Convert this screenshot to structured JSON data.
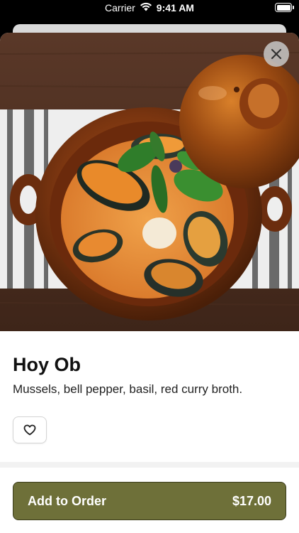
{
  "status_bar": {
    "carrier": "Carrier",
    "time": "9:41 AM",
    "icons": [
      "wifi-icon",
      "battery-icon"
    ]
  },
  "item": {
    "title": "Hoy Ob",
    "description": "Mussels, bell pepper, basil, red curry broth."
  },
  "actions": {
    "close_icon": "close-icon",
    "favorite_icon": "heart-outline-icon",
    "add_to_order_label": "Add to Order",
    "price": "$17.00"
  },
  "colors": {
    "accent": "#6e7039",
    "accent_border": "#3c3d1c",
    "close_button_bg": "#c8c8c8"
  }
}
